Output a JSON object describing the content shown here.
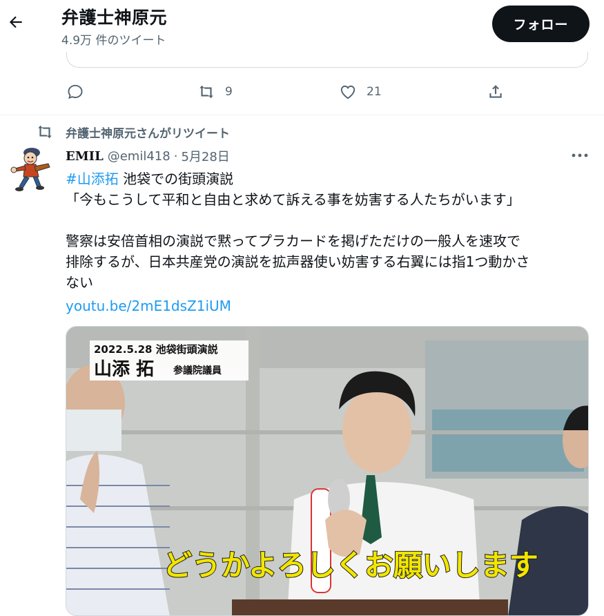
{
  "header": {
    "title": "弁護士神原元",
    "tweet_count": "4.9万 件のツイート",
    "follow_label": "フォロー"
  },
  "prev_tweet": {
    "reply_count": "",
    "retweet_count": "9",
    "like_count": "21"
  },
  "retweet_banner": "弁護士神原元さんがリツイート",
  "tweet": {
    "author_name": "EMIL",
    "handle": "@emil418",
    "separator": "·",
    "date": "5月28日",
    "hashtag": "#山添拓",
    "line1_rest": " 池袋での街頭演説",
    "line2": "「今もこうして平和と自由と求めて訴える事を妨害する人たちがいます」",
    "line3": "警察は安倍首相の演説で黙ってプラカードを掲げただけの一般人を速攻で",
    "line4": "排除するが、日本共産党の演説を拡声器使い妨害する右翼には指1つ動かさ",
    "line5": "ない",
    "link": "youtu.be/2mE1dsZ1iUM"
  },
  "media": {
    "caption_date": "2022.5.28 池袋街頭演説",
    "caption_name": "山添 拓",
    "caption_title": "参議院議員",
    "subtitle": "どうかよろしくお願いします"
  },
  "colors": {
    "accent": "#1d9bf0",
    "secondary_text": "#536471",
    "primary_text": "#0f1419",
    "subtitle_yellow": "#f2e600"
  },
  "icons": {
    "back": "arrow-left-icon",
    "reply": "reply-icon",
    "retweet": "retweet-icon",
    "like": "heart-icon",
    "share": "share-icon",
    "more": "more-icon"
  }
}
